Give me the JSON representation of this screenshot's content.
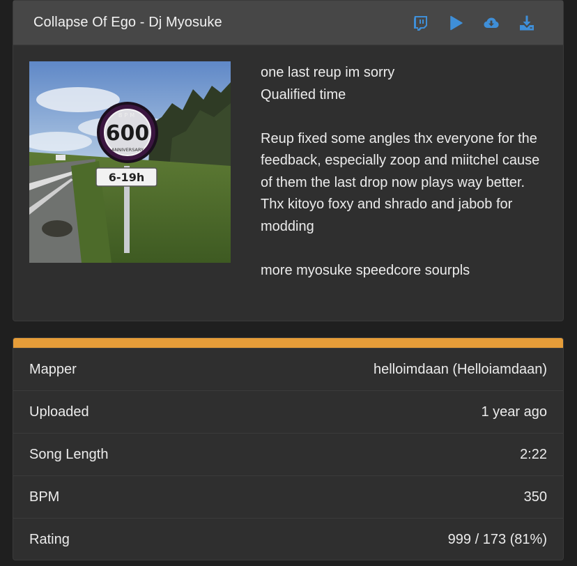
{
  "map": {
    "title": "Collapse Of Ego - Dj Myosuke",
    "actions": [
      {
        "name": "twitch-icon"
      },
      {
        "name": "play-icon"
      },
      {
        "name": "cloud-download-icon"
      },
      {
        "name": "download-icon"
      }
    ],
    "accent_color": "#3f8fd8",
    "cover": {
      "sign_bpm": "BPM",
      "sign_number": "600",
      "sign_sub": "ANNIVERSARY",
      "plate_text": "6-19h"
    },
    "description": "one last reup im sorry\nQualified time\n\nReup fixed some angles thx everyone for the feedback, especially zoop and miitchel cause of them the last drop now plays way better.\nThx kitoyo foxy and shrado and jabob for modding\n\nmore myosuke speedcore sourpls"
  },
  "stats": {
    "accent_color": "#e69d39",
    "rows": [
      {
        "label": "Mapper",
        "value": "helloimdaan (Helloiamdaan)"
      },
      {
        "label": "Uploaded",
        "value": "1 year ago"
      },
      {
        "label": "Song Length",
        "value": "2:22"
      },
      {
        "label": "BPM",
        "value": "350"
      },
      {
        "label": "Rating",
        "value": "999 / 173 (81%)"
      }
    ]
  }
}
